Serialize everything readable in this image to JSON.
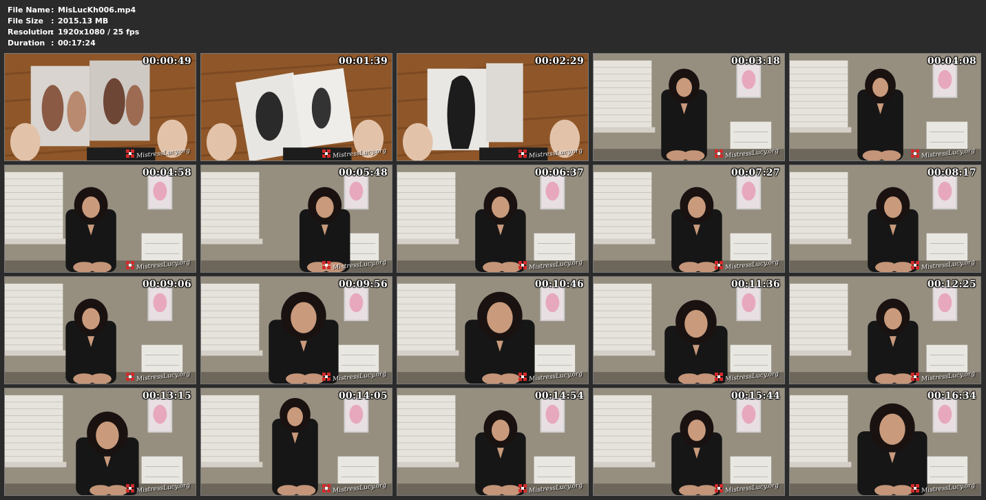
{
  "file_info": {
    "rows": [
      {
        "label": "File Name",
        "separator": ":",
        "value": "MisLucKh006.mp4"
      },
      {
        "label": "File Size",
        "separator": ":",
        "value": "2015.13 MB"
      },
      {
        "label": "Resolution",
        "separator": ":",
        "value": "1920x1080 / 25 fps"
      },
      {
        "label": "Duration",
        "separator": ":",
        "value": "00:17:24"
      }
    ]
  },
  "watermark_text": "MistressLucy.org",
  "thumbnails": [
    {
      "time": "00:00:49",
      "scene": "book-color"
    },
    {
      "time": "00:01:39",
      "scene": "book-bw"
    },
    {
      "time": "00:02:29",
      "scene": "book-bw2"
    },
    {
      "time": "00:03:18",
      "scene": "room-wide"
    },
    {
      "time": "00:04:08",
      "scene": "room-wide"
    },
    {
      "time": "00:04:58",
      "scene": "room-left"
    },
    {
      "time": "00:05:48",
      "scene": "room-right"
    },
    {
      "time": "00:06:37",
      "scene": "room-center"
    },
    {
      "time": "00:07:27",
      "scene": "room-center"
    },
    {
      "time": "00:08:17",
      "scene": "room-center"
    },
    {
      "time": "00:09:06",
      "scene": "room-left"
    },
    {
      "time": "00:09:56",
      "scene": "room-close"
    },
    {
      "time": "00:10:46",
      "scene": "room-close"
    },
    {
      "time": "00:11:36",
      "scene": "room-lean"
    },
    {
      "time": "00:12:25",
      "scene": "room-center"
    },
    {
      "time": "00:13:15",
      "scene": "room-lean"
    },
    {
      "time": "00:14:05",
      "scene": "room-stand"
    },
    {
      "time": "00:14:54",
      "scene": "room-center"
    },
    {
      "time": "00:15:44",
      "scene": "room-center"
    },
    {
      "time": "00:16:34",
      "scene": "room-close"
    }
  ],
  "colors": {
    "background": "#2b2b2b",
    "text": "#ffffff",
    "thumb_border": "#7a7a7a"
  }
}
